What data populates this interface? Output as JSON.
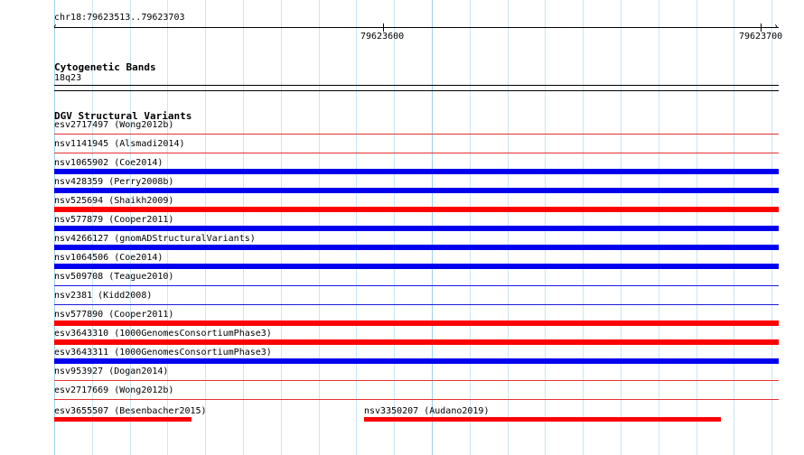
{
  "ruler": {
    "location": "chr18:79623513..79623703",
    "tick_labels": [
      "79623600",
      "79623700"
    ]
  },
  "colors": {
    "grid": "#c9e6f5",
    "band_line": "#000000",
    "variant_line_red": "#e53030",
    "variant_line_blue": "#1a1adc",
    "bar_red": "#ff0000",
    "bar_blue": "#0000ee"
  },
  "cytoband_track": {
    "title": "Cytogenetic Bands",
    "band": "18q23"
  },
  "dgv_track": {
    "title": "DGV Structural Variants",
    "rows": [
      {
        "label": "esv2717497 (Wong2012b)",
        "type": "loss",
        "bar": "none"
      },
      {
        "label": "nsv1141945 (Alsmadi2014)",
        "type": "loss",
        "bar": "none"
      },
      {
        "label": "nsv1065902 (Coe2014)",
        "type": "gain",
        "bar": "full"
      },
      {
        "label": "nsv428359 (Perry2008b)",
        "type": "gain",
        "bar": "full"
      },
      {
        "label": "nsv525694 (Shaikh2009)",
        "type": "loss",
        "bar": "full"
      },
      {
        "label": "nsv577879 (Cooper2011)",
        "type": "gain",
        "bar": "full"
      },
      {
        "label": "nsv4266127 (gnomADStructuralVariants)",
        "type": "gain",
        "bar": "full"
      },
      {
        "label": "nsv1064506 (Coe2014)",
        "type": "gain",
        "bar": "full"
      },
      {
        "label": "nsv509708 (Teague2010)",
        "type": "gain",
        "bar": "none"
      },
      {
        "label": "nsv2381 (Kidd2008)",
        "type": "gain",
        "bar": "none"
      },
      {
        "label": "nsv577890 (Cooper2011)",
        "type": "loss",
        "bar": "full"
      },
      {
        "label": "esv3643310 (1000GenomesConsortiumPhase3)",
        "type": "loss",
        "bar": "full"
      },
      {
        "label": "esv3643311 (1000GenomesConsortiumPhase3)",
        "type": "gain",
        "bar": "full"
      },
      {
        "label": "nsv953927 (Dogan2014)",
        "type": "loss",
        "bar": "none"
      },
      {
        "label": "esv2717669 (Wong2012b)",
        "type": "loss",
        "bar": "none"
      }
    ],
    "last_row": [
      {
        "label": "esv3655507 (Besenbacher2015)",
        "type": "loss"
      },
      {
        "label": "nsv3350207 (Audano2019)",
        "type": "loss"
      }
    ]
  }
}
